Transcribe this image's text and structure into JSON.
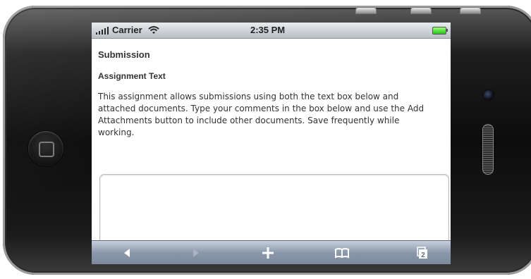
{
  "status_bar": {
    "carrier": "Carrier",
    "time": "2:35 PM",
    "signal_icon": "signal-bars-icon",
    "wifi_icon": "wifi-icon",
    "battery_icon": "battery-icon"
  },
  "page": {
    "title": "Submission",
    "section_title": "Assignment Text",
    "description": "This assignment allows submissions using both the text box below and attached documents. Type your comments in the box below and use the Add Attachments button to include other documents. Save frequently while working.",
    "text_box_value": ""
  },
  "toolbar": {
    "buttons": [
      {
        "icon": "back-arrow-icon",
        "enabled": true
      },
      {
        "icon": "forward-arrow-icon",
        "enabled": false
      },
      {
        "icon": "plus-icon",
        "enabled": true
      },
      {
        "icon": "bookmarks-icon",
        "enabled": true
      },
      {
        "icon": "pages-icon",
        "label": "2",
        "enabled": true
      }
    ]
  },
  "colors": {
    "toolbar": "#8a97aa",
    "status_bar": "#c3c8cf",
    "text": "#333333",
    "battery": "#2bc01a"
  }
}
